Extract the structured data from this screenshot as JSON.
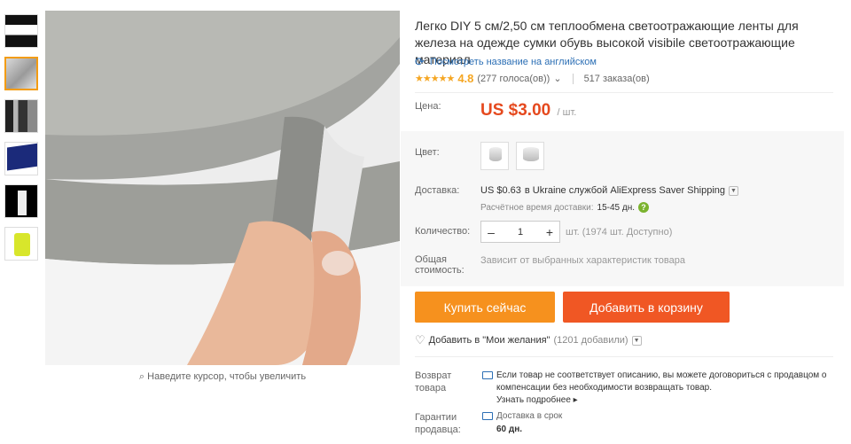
{
  "product": {
    "title": "Легко DIY 5 см/2,50 см теплообмена светоотражающие ленты для железа на одежде сумки обувь высокой visibile светоотражающие материал",
    "translate_link": "Посмотреть название на английском",
    "rating": "4.8",
    "stars": "★★★★★",
    "votes": "(277 голоса(ов))",
    "orders": "517 заказа(ов)"
  },
  "gallery": {
    "zoom_hint": "Наведите курсор, чтобы увеличить"
  },
  "price": {
    "label": "Цена:",
    "value": "US $3.00",
    "unit": "/ шт."
  },
  "color": {
    "label": "Цвет:"
  },
  "shipping": {
    "label": "Доставка:",
    "amount": "US $0.63",
    "dest": "в Ukraine службой AliExpress Saver Shipping",
    "eta_label": "Расчётное время доставки:",
    "eta_value": "15-45 дн."
  },
  "quantity": {
    "label": "Количество:",
    "value": "1",
    "stock": "шт. (1974 шт. Доступно)"
  },
  "total": {
    "label_line1": "Общая",
    "label_line2": "стоимость:",
    "value": "Зависит от выбранных характеристик товара"
  },
  "buttons": {
    "buy": "Купить сейчас",
    "cart": "Добавить в корзину"
  },
  "wishlist": {
    "text": "Добавить в \"Мои желания\"",
    "count": "(1201 добавили)"
  },
  "returns": {
    "label_line1": "Возврат",
    "label_line2": "товара",
    "text": "Если товар не соответствует описанию, вы можете договориться с продавцом о компенсации без необходимости возвращать товар.",
    "more": "Узнать подробнее"
  },
  "guarantee": {
    "label_line1": "Гарантии",
    "label_line2": "продавца:",
    "title": "Доставка в срок",
    "days": "60 дн."
  },
  "colors": {
    "price": "#e5491e",
    "buy": "#f6911e",
    "cart": "#f05724",
    "link": "#2c6fb5",
    "star": "#f5a623"
  }
}
